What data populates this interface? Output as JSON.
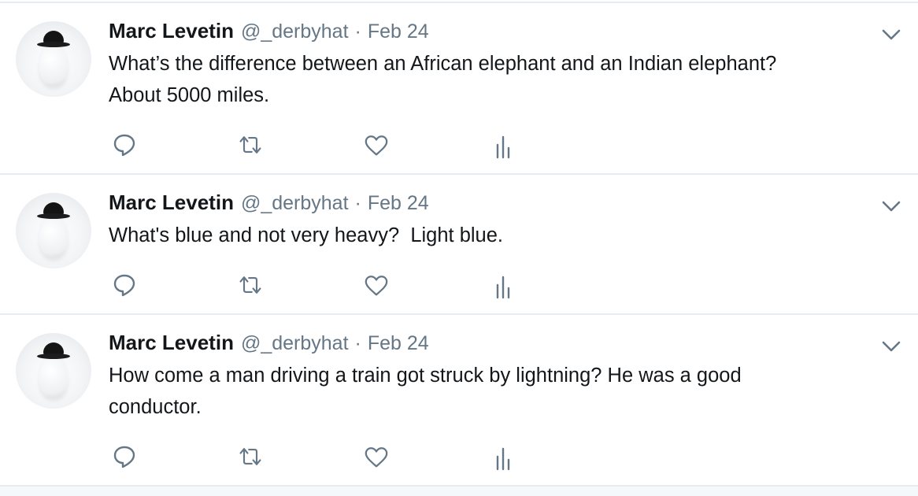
{
  "colors": {
    "text": "#14171a",
    "secondary": "#657786",
    "divider": "#e6ecf0",
    "action_icon": "#657786"
  },
  "tweets": [
    {
      "author_name": "Marc Levetin",
      "handle": "@_derbyhat",
      "separator": "·",
      "date": "Feb 24",
      "text_lines": [
        "What’s the difference between an African elephant and an Indian elephant?",
        "About 5000 miles."
      ],
      "avatar_icon": "egg-derby-hat-avatar",
      "menu_icon": "chevron-down-icon",
      "actions": [
        "reply-icon",
        "retweet-icon",
        "like-icon",
        "analytics-icon"
      ]
    },
    {
      "author_name": "Marc Levetin",
      "handle": "@_derbyhat",
      "separator": "·",
      "date": "Feb 24",
      "text_lines": [
        "What's blue and not very heavy?  Light blue."
      ],
      "avatar_icon": "egg-derby-hat-avatar",
      "menu_icon": "chevron-down-icon",
      "actions": [
        "reply-icon",
        "retweet-icon",
        "like-icon",
        "analytics-icon"
      ]
    },
    {
      "author_name": "Marc Levetin",
      "handle": "@_derbyhat",
      "separator": "·",
      "date": "Feb 24",
      "text_lines": [
        "How come a man driving a train got struck by lightning? He was a good",
        "conductor."
      ],
      "avatar_icon": "egg-derby-hat-avatar",
      "menu_icon": "chevron-down-icon",
      "actions": [
        "reply-icon",
        "retweet-icon",
        "like-icon",
        "analytics-icon"
      ]
    }
  ]
}
